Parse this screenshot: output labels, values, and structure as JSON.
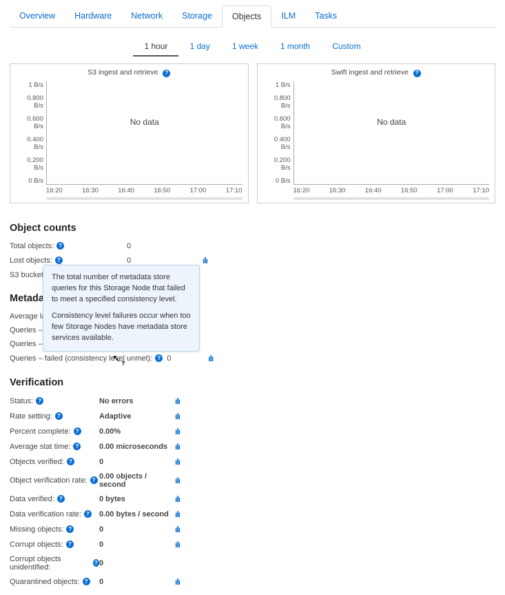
{
  "tabs": {
    "overview": "Overview",
    "hardware": "Hardware",
    "network": "Network",
    "storage": "Storage",
    "objects": "Objects",
    "ilm": "ILM",
    "tasks": "Tasks"
  },
  "timerange": {
    "hour": "1 hour",
    "day": "1 day",
    "week": "1 week",
    "month": "1 month",
    "custom": "Custom"
  },
  "chart_data": [
    {
      "type": "line",
      "title": "S3 ingest and retrieve",
      "y_ticks": [
        "1 B/s",
        "0.800 B/s",
        "0.600 B/s",
        "0.400 B/s",
        "0.200 B/s",
        "0 B/s"
      ],
      "x_ticks": [
        "16:20",
        "16:30",
        "16:40",
        "16:50",
        "17:00",
        "17:10"
      ],
      "ylim": [
        0,
        1
      ],
      "no_data_text": "No data",
      "series": []
    },
    {
      "type": "line",
      "title": "Swift ingest and retrieve",
      "y_ticks": [
        "1 B/s",
        "0.800 B/s",
        "0.600 B/s",
        "0.400 B/s",
        "0.200 B/s",
        "0 B/s"
      ],
      "x_ticks": [
        "16:20",
        "16:30",
        "16:40",
        "16:50",
        "17:00",
        "17:10"
      ],
      "ylim": [
        0,
        1
      ],
      "no_data_text": "No data",
      "series": []
    }
  ],
  "sections": {
    "object_counts": {
      "title": "Object counts",
      "rows": {
        "total": {
          "label": "Total objects:",
          "value": "0"
        },
        "lost": {
          "label": "Lost objects:",
          "value": "0"
        },
        "buckets": {
          "label": "S3 buckets an",
          "value": ""
        }
      }
    },
    "metadata": {
      "title": "Metadat",
      "rows": {
        "latency": {
          "label": "Average laten",
          "value": ""
        },
        "success": {
          "label": "Queries – succ",
          "value": ""
        },
        "failed": {
          "label": "Queries – faile",
          "value": ""
        },
        "consistency": {
          "label": "Queries – failed (consistency level unmet):",
          "value": "0"
        }
      }
    },
    "verification": {
      "title": "Verification",
      "rows": {
        "status": {
          "label": "Status:",
          "value": "No errors"
        },
        "rate_setting": {
          "label": "Rate setting:",
          "value": "Adaptive"
        },
        "percent": {
          "label": "Percent complete:",
          "value": "0.00%"
        },
        "avg_stat": {
          "label": "Average stat time:",
          "value": "0.00 microseconds"
        },
        "obj_verified": {
          "label": "Objects verified:",
          "value": "0"
        },
        "obj_rate": {
          "label": "Object verification rate:",
          "value": "0.00 objects / second"
        },
        "data_verified": {
          "label": "Data verified:",
          "value": "0 bytes"
        },
        "data_rate": {
          "label": "Data verification rate:",
          "value": "0.00 bytes / second"
        },
        "missing": {
          "label": "Missing objects:",
          "value": "0"
        },
        "corrupt": {
          "label": "Corrupt objects:",
          "value": "0"
        },
        "corrupt_unid": {
          "label": "Corrupt objects unidentified:",
          "value": "0"
        },
        "quarantined": {
          "label": "Quarantined objects:",
          "value": "0"
        }
      }
    }
  },
  "tooltip": {
    "p1": "The total number of metadata store queries for this Storage Node that failed to meet a specified consistency level.",
    "p2": "Consistency level failures occur when too few Storage Nodes have metadata store services available."
  },
  "icons": {
    "help": "?",
    "chart": "ılı"
  }
}
